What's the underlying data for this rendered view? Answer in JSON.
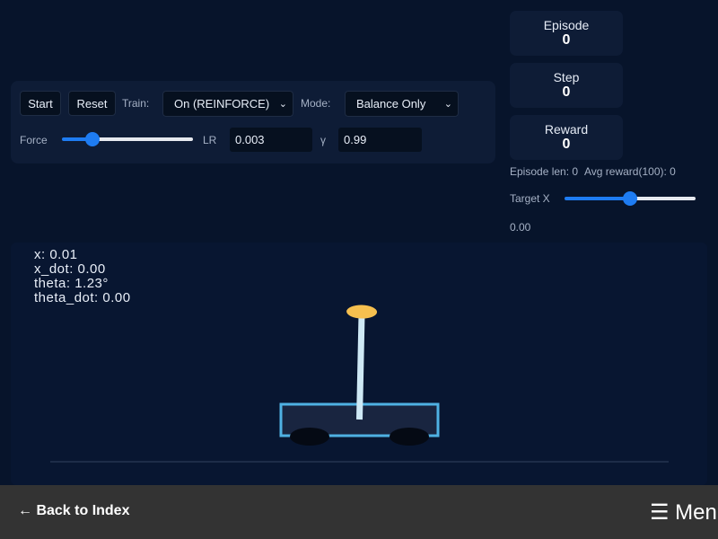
{
  "controls": {
    "start_label": "Start",
    "reset_label": "Reset",
    "train_label": "Train:",
    "train_value": "On (REINFORCE)",
    "mode_label": "Mode:",
    "mode_value": "Balance Only",
    "force_label": "Force",
    "force_level": 0.2,
    "lr_label": "LR",
    "lr_value": "0.003",
    "gamma_label": "γ",
    "gamma_value": "0.99"
  },
  "stats": [
    {
      "title": "Episode",
      "value": "0"
    },
    {
      "title": "Step",
      "value": "0"
    },
    {
      "title": "Reward",
      "value": "0"
    }
  ],
  "info": {
    "episode_len": "Episode len: 0",
    "avg_reward": "Avg reward(100): 0",
    "target_label": "Target X",
    "target_level": 0.5,
    "target_value": "0.00"
  },
  "readout": {
    "x": "x: 0.01",
    "x_dot": "x_dot: 0.00",
    "theta": "theta: 1.23°",
    "theta_dot": "theta_dot: 0.00"
  },
  "sim": {
    "theta_deg": 1.23
  },
  "footer": {
    "back_label": "← Back to Index",
    "menu_label": "☰ Menu"
  },
  "colors": {
    "accent": "#1e7cf2",
    "pole": "#cfe9f5",
    "bob": "#f6c04f",
    "cart_border": "#4fb1e3"
  }
}
